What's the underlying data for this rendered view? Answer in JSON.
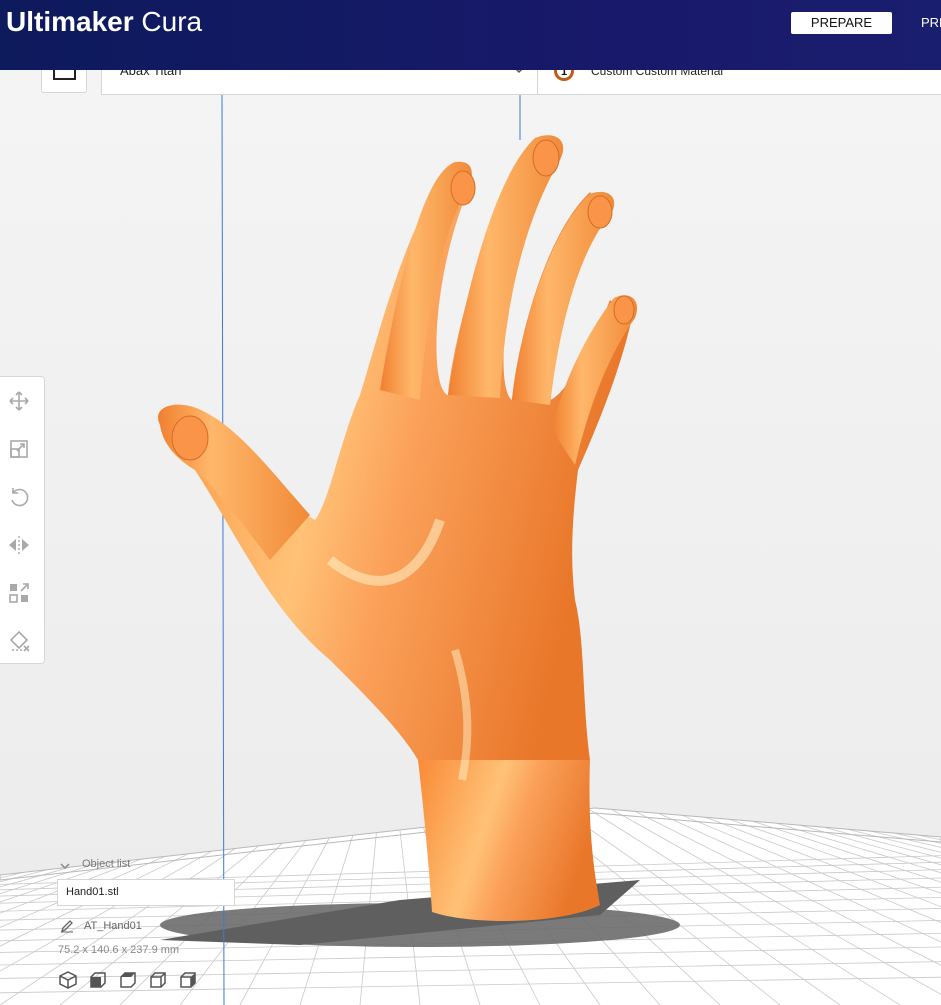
{
  "header": {
    "brand_bold": "Ultimaker",
    "brand_light": "Cura",
    "stage_active": "PREPARE",
    "stage_next": "PRE"
  },
  "printer": {
    "name": "Abax Titan"
  },
  "extruder": {
    "number": "1",
    "material": "Custom Custom Material"
  },
  "object_list": {
    "header": "Object list",
    "file": "Hand01.stl",
    "name": "AT_Hand01",
    "dimensions": "75.2 x 140.6 x 237.9 mm"
  },
  "icons": {
    "toolbar": [
      "move-icon",
      "scale-icon",
      "rotate-icon",
      "mirror-icon",
      "per-model-settings-icon",
      "support-blocker-icon"
    ],
    "views": [
      "3d-view-icon",
      "front-view-icon",
      "top-view-icon",
      "left-view-icon",
      "right-view-icon"
    ]
  },
  "colors": {
    "header": "#0d1a5c",
    "model": "#f9923f",
    "accent": "#c25a1a"
  }
}
